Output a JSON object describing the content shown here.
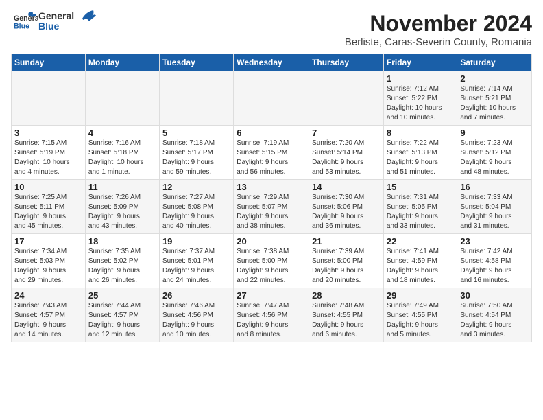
{
  "logo": {
    "general": "General",
    "blue": "Blue"
  },
  "title": "November 2024",
  "subtitle": "Berliste, Caras-Severin County, Romania",
  "days_of_week": [
    "Sunday",
    "Monday",
    "Tuesday",
    "Wednesday",
    "Thursday",
    "Friday",
    "Saturday"
  ],
  "weeks": [
    [
      {
        "day": "",
        "info": ""
      },
      {
        "day": "",
        "info": ""
      },
      {
        "day": "",
        "info": ""
      },
      {
        "day": "",
        "info": ""
      },
      {
        "day": "",
        "info": ""
      },
      {
        "day": "1",
        "info": "Sunrise: 7:12 AM\nSunset: 5:22 PM\nDaylight: 10 hours\nand 10 minutes."
      },
      {
        "day": "2",
        "info": "Sunrise: 7:14 AM\nSunset: 5:21 PM\nDaylight: 10 hours\nand 7 minutes."
      }
    ],
    [
      {
        "day": "3",
        "info": "Sunrise: 7:15 AM\nSunset: 5:19 PM\nDaylight: 10 hours\nand 4 minutes."
      },
      {
        "day": "4",
        "info": "Sunrise: 7:16 AM\nSunset: 5:18 PM\nDaylight: 10 hours\nand 1 minute."
      },
      {
        "day": "5",
        "info": "Sunrise: 7:18 AM\nSunset: 5:17 PM\nDaylight: 9 hours\nand 59 minutes."
      },
      {
        "day": "6",
        "info": "Sunrise: 7:19 AM\nSunset: 5:15 PM\nDaylight: 9 hours\nand 56 minutes."
      },
      {
        "day": "7",
        "info": "Sunrise: 7:20 AM\nSunset: 5:14 PM\nDaylight: 9 hours\nand 53 minutes."
      },
      {
        "day": "8",
        "info": "Sunrise: 7:22 AM\nSunset: 5:13 PM\nDaylight: 9 hours\nand 51 minutes."
      },
      {
        "day": "9",
        "info": "Sunrise: 7:23 AM\nSunset: 5:12 PM\nDaylight: 9 hours\nand 48 minutes."
      }
    ],
    [
      {
        "day": "10",
        "info": "Sunrise: 7:25 AM\nSunset: 5:11 PM\nDaylight: 9 hours\nand 45 minutes."
      },
      {
        "day": "11",
        "info": "Sunrise: 7:26 AM\nSunset: 5:09 PM\nDaylight: 9 hours\nand 43 minutes."
      },
      {
        "day": "12",
        "info": "Sunrise: 7:27 AM\nSunset: 5:08 PM\nDaylight: 9 hours\nand 40 minutes."
      },
      {
        "day": "13",
        "info": "Sunrise: 7:29 AM\nSunset: 5:07 PM\nDaylight: 9 hours\nand 38 minutes."
      },
      {
        "day": "14",
        "info": "Sunrise: 7:30 AM\nSunset: 5:06 PM\nDaylight: 9 hours\nand 36 minutes."
      },
      {
        "day": "15",
        "info": "Sunrise: 7:31 AM\nSunset: 5:05 PM\nDaylight: 9 hours\nand 33 minutes."
      },
      {
        "day": "16",
        "info": "Sunrise: 7:33 AM\nSunset: 5:04 PM\nDaylight: 9 hours\nand 31 minutes."
      }
    ],
    [
      {
        "day": "17",
        "info": "Sunrise: 7:34 AM\nSunset: 5:03 PM\nDaylight: 9 hours\nand 29 minutes."
      },
      {
        "day": "18",
        "info": "Sunrise: 7:35 AM\nSunset: 5:02 PM\nDaylight: 9 hours\nand 26 minutes."
      },
      {
        "day": "19",
        "info": "Sunrise: 7:37 AM\nSunset: 5:01 PM\nDaylight: 9 hours\nand 24 minutes."
      },
      {
        "day": "20",
        "info": "Sunrise: 7:38 AM\nSunset: 5:00 PM\nDaylight: 9 hours\nand 22 minutes."
      },
      {
        "day": "21",
        "info": "Sunrise: 7:39 AM\nSunset: 5:00 PM\nDaylight: 9 hours\nand 20 minutes."
      },
      {
        "day": "22",
        "info": "Sunrise: 7:41 AM\nSunset: 4:59 PM\nDaylight: 9 hours\nand 18 minutes."
      },
      {
        "day": "23",
        "info": "Sunrise: 7:42 AM\nSunset: 4:58 PM\nDaylight: 9 hours\nand 16 minutes."
      }
    ],
    [
      {
        "day": "24",
        "info": "Sunrise: 7:43 AM\nSunset: 4:57 PM\nDaylight: 9 hours\nand 14 minutes."
      },
      {
        "day": "25",
        "info": "Sunrise: 7:44 AM\nSunset: 4:57 PM\nDaylight: 9 hours\nand 12 minutes."
      },
      {
        "day": "26",
        "info": "Sunrise: 7:46 AM\nSunset: 4:56 PM\nDaylight: 9 hours\nand 10 minutes."
      },
      {
        "day": "27",
        "info": "Sunrise: 7:47 AM\nSunset: 4:56 PM\nDaylight: 9 hours\nand 8 minutes."
      },
      {
        "day": "28",
        "info": "Sunrise: 7:48 AM\nSunset: 4:55 PM\nDaylight: 9 hours\nand 6 minutes."
      },
      {
        "day": "29",
        "info": "Sunrise: 7:49 AM\nSunset: 4:55 PM\nDaylight: 9 hours\nand 5 minutes."
      },
      {
        "day": "30",
        "info": "Sunrise: 7:50 AM\nSunset: 4:54 PM\nDaylight: 9 hours\nand 3 minutes."
      }
    ]
  ]
}
